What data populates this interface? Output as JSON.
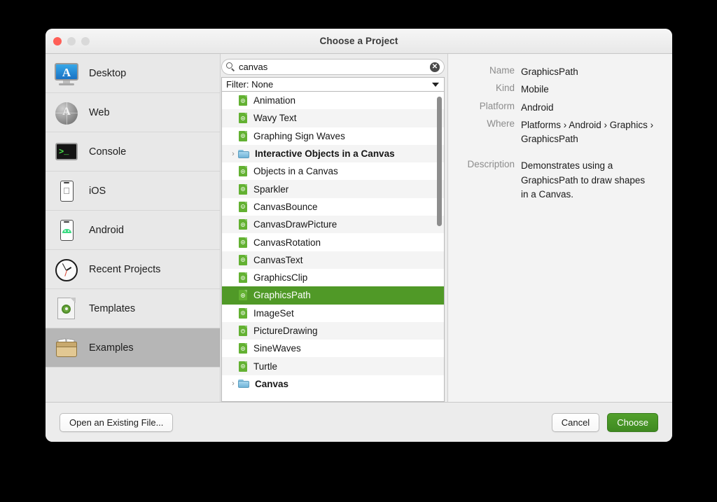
{
  "window": {
    "title": "Choose a Project",
    "traffic_lights": [
      "close",
      "minimize",
      "zoom"
    ]
  },
  "sidebar": {
    "items": [
      {
        "label": "Desktop",
        "icon": "desktop-monitor-icon",
        "selected": false
      },
      {
        "label": "Web",
        "icon": "globe-icon",
        "selected": false
      },
      {
        "label": "Console",
        "icon": "terminal-icon",
        "selected": false
      },
      {
        "label": "iOS",
        "icon": "ios-phone-icon",
        "selected": false
      },
      {
        "label": "Android",
        "icon": "android-phone-icon",
        "selected": false
      },
      {
        "label": "Recent Projects",
        "icon": "clock-icon",
        "selected": false
      },
      {
        "label": "Templates",
        "icon": "template-document-icon",
        "selected": false
      },
      {
        "label": "Examples",
        "icon": "examples-folder-icon",
        "selected": true
      }
    ]
  },
  "search": {
    "value": "canvas",
    "placeholder": "Search",
    "icon": "search-icon",
    "clear_icon": "clear-circle-icon",
    "clear_glyph": "✕"
  },
  "filter": {
    "label": "Filter: None",
    "icon": "chevron-down-icon"
  },
  "list": {
    "rows": [
      {
        "label": "Animation",
        "type": "project",
        "expandable": false,
        "selected": false
      },
      {
        "label": "Wavy Text",
        "type": "project",
        "expandable": false,
        "selected": false
      },
      {
        "label": "Graphing Sign Waves",
        "type": "project",
        "expandable": false,
        "selected": false
      },
      {
        "label": "Interactive Objects in a Canvas",
        "type": "folder",
        "expandable": true,
        "selected": false
      },
      {
        "label": "Objects in a Canvas",
        "type": "project",
        "expandable": false,
        "selected": false
      },
      {
        "label": "Sparkler",
        "type": "project",
        "expandable": false,
        "selected": false
      },
      {
        "label": "CanvasBounce",
        "type": "project",
        "expandable": false,
        "selected": false
      },
      {
        "label": "CanvasDrawPicture",
        "type": "project",
        "expandable": false,
        "selected": false
      },
      {
        "label": "CanvasRotation",
        "type": "project",
        "expandable": false,
        "selected": false
      },
      {
        "label": "CanvasText",
        "type": "project",
        "expandable": false,
        "selected": false
      },
      {
        "label": "GraphicsClip",
        "type": "project",
        "expandable": false,
        "selected": false
      },
      {
        "label": "GraphicsPath",
        "type": "project",
        "expandable": false,
        "selected": true
      },
      {
        "label": "ImageSet",
        "type": "project",
        "expandable": false,
        "selected": false
      },
      {
        "label": "PictureDrawing",
        "type": "project",
        "expandable": false,
        "selected": false
      },
      {
        "label": "SineWaves",
        "type": "project",
        "expandable": false,
        "selected": false
      },
      {
        "label": "Turtle",
        "type": "project",
        "expandable": false,
        "selected": false
      },
      {
        "label": "Canvas",
        "type": "folder",
        "expandable": true,
        "selected": false
      }
    ],
    "disclosure_glyph": "›"
  },
  "detail": {
    "fields": [
      {
        "label": "Name",
        "value": "GraphicsPath"
      },
      {
        "label": "Kind",
        "value": "Mobile"
      },
      {
        "label": "Platform",
        "value": "Android"
      },
      {
        "label": "Where",
        "value": "Platforms › Android › Graphics › GraphicsPath"
      }
    ],
    "description_label": "Description",
    "description_value": "Demonstrates using a GraphicsPath to draw shapes in a Canvas."
  },
  "footer": {
    "open_existing": "Open an Existing File...",
    "cancel": "Cancel",
    "choose": "Choose"
  },
  "colors": {
    "selection_green": "#509927",
    "primary_button_green": "#489327",
    "sidebar_selected": "#b6b6b6",
    "window_chrome": "#ececec"
  }
}
